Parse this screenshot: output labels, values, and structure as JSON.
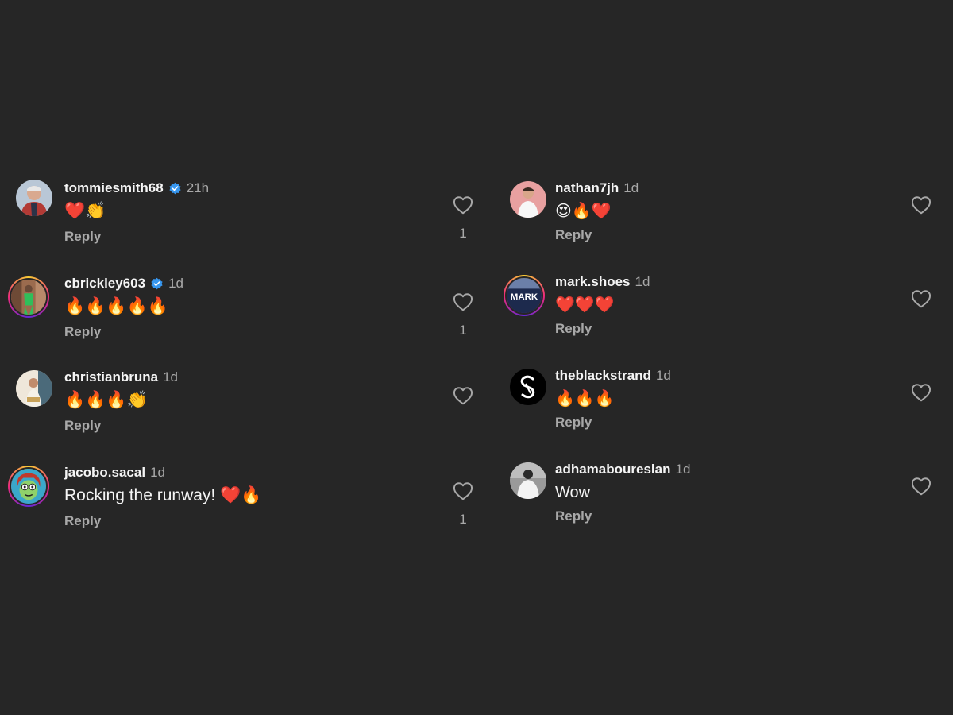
{
  "left_comments": [
    {
      "username": "tommiesmith68",
      "verified": true,
      "time": "21h",
      "text": "❤️👏",
      "reply": "Reply",
      "likes": "1",
      "avatar": "avatar-photo-man"
    },
    {
      "username": "cbrickley603",
      "verified": true,
      "time": "1d",
      "text": "🔥🔥🔥🔥🔥",
      "reply": "Reply",
      "likes": "1",
      "avatar": "avatar-photo-green-outfit"
    },
    {
      "username": "christianbruna",
      "verified": false,
      "time": "1d",
      "text": "🔥🔥🔥👏",
      "reply": "Reply",
      "likes": "",
      "avatar": "avatar-photo-man-sitting"
    },
    {
      "username": "jacobo.sacal",
      "verified": false,
      "time": "1d",
      "text": "Rocking the runway! ❤️🔥",
      "reply": "Reply",
      "likes": "1",
      "avatar": "avatar-cartoon"
    }
  ],
  "right_comments": [
    {
      "username": "nathan7jh",
      "verified": false,
      "time": "1d",
      "text": "😍🔥❤️",
      "reply": "Reply",
      "likes": "",
      "avatar": "avatar-photo-man-white-shirt"
    },
    {
      "username": "mark.shoes",
      "verified": false,
      "time": "1d",
      "text": "❤️❤️❤️",
      "reply": "Reply",
      "likes": "",
      "avatar": "avatar-logo-mark",
      "avatar_text": "MARK"
    },
    {
      "username": "theblackstrand",
      "verified": false,
      "time": "1d",
      "text": "🔥🔥🔥",
      "reply": "Reply",
      "likes": "",
      "avatar": "avatar-logo-s"
    },
    {
      "username": "adhamabouresl an",
      "verified": false,
      "time": "1d",
      "text": "Wow",
      "reply": "Reply",
      "likes": "",
      "avatar": "avatar-photo-back"
    }
  ],
  "colors": {
    "background": "#262626",
    "text_primary": "#f5f5f5",
    "text_secondary": "#a8a8a8",
    "verified_blue": "#3797f0"
  }
}
